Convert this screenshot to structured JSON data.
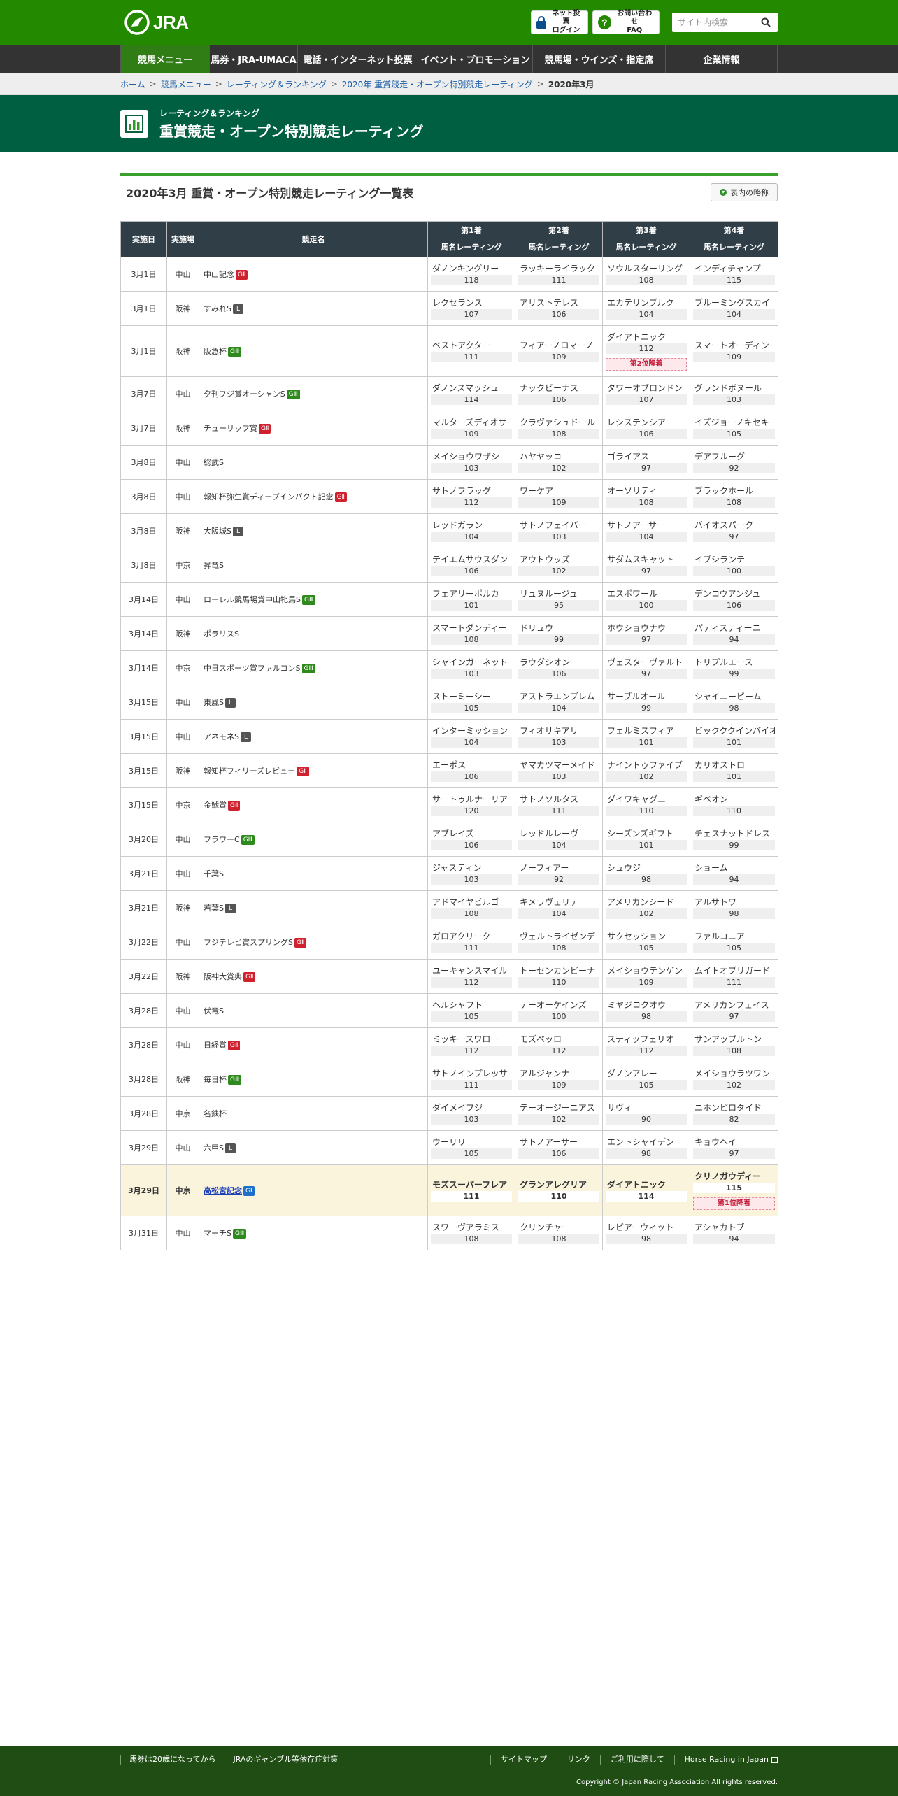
{
  "header": {
    "logo_text": "JRA",
    "login_line1": "ネット投票",
    "login_line2": "ログイン",
    "faq_line1": "お問い合わせ",
    "faq_line2": "FAQ",
    "search_placeholder": "サイト内検索"
  },
  "nav": {
    "items": [
      {
        "label": "競馬メニュー",
        "active": true
      },
      {
        "label": "馬券・JRA-UMACA"
      },
      {
        "label": "電話・インターネット投票"
      },
      {
        "label": "イベント・プロモーション"
      },
      {
        "label": "競馬場・ウインズ・指定席"
      },
      {
        "label": "企業情報"
      }
    ]
  },
  "breadcrumb": {
    "items": [
      "ホーム",
      "競馬メニュー",
      "レーティング＆ランキング",
      "2020年 重賞競走・オープン特別競走レーティング"
    ],
    "current": "2020年3月"
  },
  "title": {
    "sub": "レーティング＆ランキング",
    "main": "重賞競走・オープン特別競走レーティング"
  },
  "section": {
    "title": "2020年3月 重賞・オープン特別競走レーティング一覧表",
    "legend_button": "表内の略称"
  },
  "table": {
    "headers": {
      "date": "実施日",
      "venue": "実施場",
      "race": "競走名",
      "p1": "第1着",
      "p2": "第2着",
      "p3": "第3着",
      "p4": "第4着",
      "sub": "馬名レーティング"
    },
    "rows": [
      {
        "date": "3月1日",
        "venue": "中山",
        "race": "中山記念",
        "grade": "GⅡ",
        "g": "g2",
        "h": [
          [
            "ダノンキングリー",
            "118"
          ],
          [
            "ラッキーライラック",
            "111"
          ],
          [
            "ソウルスターリング",
            "108"
          ],
          [
            "インディチャンプ",
            "115"
          ]
        ]
      },
      {
        "date": "3月1日",
        "venue": "阪神",
        "race": "すみれS",
        "grade": "L",
        "g": "gl",
        "h": [
          [
            "レクセランス",
            "107"
          ],
          [
            "アリストテレス",
            "106"
          ],
          [
            "エカテリンブルク",
            "104"
          ],
          [
            "ブルーミングスカイ",
            "104"
          ]
        ]
      },
      {
        "date": "3月1日",
        "venue": "阪神",
        "race": "阪急杯",
        "grade": "GⅢ",
        "g": "g3",
        "h": [
          [
            "ベストアクター",
            "111"
          ],
          [
            "フィアーノロマーノ",
            "109"
          ],
          [
            "ダイアトニック",
            "112",
            "第2位降着"
          ],
          [
            "スマートオーディン",
            "109"
          ]
        ]
      },
      {
        "date": "3月7日",
        "venue": "中山",
        "race": "夕刊フジ賞オーシャンS",
        "grade": "GⅢ",
        "g": "g3",
        "h": [
          [
            "ダノンスマッシュ",
            "114"
          ],
          [
            "ナックビーナス",
            "106"
          ],
          [
            "タワーオブロンドン",
            "107"
          ],
          [
            "グランドボヌール",
            "103"
          ]
        ]
      },
      {
        "date": "3月7日",
        "venue": "阪神",
        "race": "チューリップ賞",
        "grade": "GⅡ",
        "g": "g2",
        "h": [
          [
            "マルターズディオサ",
            "109"
          ],
          [
            "クラヴァシュドール",
            "108"
          ],
          [
            "レシステンシア",
            "106"
          ],
          [
            "イズジョーノキセキ",
            "105"
          ]
        ]
      },
      {
        "date": "3月8日",
        "venue": "中山",
        "race": "総武S",
        "grade": "",
        "g": "",
        "h": [
          [
            "メイショウワザシ",
            "103"
          ],
          [
            "ハヤヤッコ",
            "102"
          ],
          [
            "ゴライアス",
            "97"
          ],
          [
            "デアフルーグ",
            "92"
          ]
        ]
      },
      {
        "date": "3月8日",
        "venue": "中山",
        "race": "報知杯弥生賞ディープインパクト記念",
        "grade": "GⅡ",
        "g": "g2",
        "h": [
          [
            "サトノフラッグ",
            "112"
          ],
          [
            "ワーケア",
            "109"
          ],
          [
            "オーソリティ",
            "108"
          ],
          [
            "ブラックホール",
            "108"
          ]
        ]
      },
      {
        "date": "3月8日",
        "venue": "阪神",
        "race": "大阪城S",
        "grade": "L",
        "g": "gl",
        "h": [
          [
            "レッドガラン",
            "104"
          ],
          [
            "サトノフェイバー",
            "103"
          ],
          [
            "サトノアーサー",
            "104"
          ],
          [
            "バイオスパーク",
            "97"
          ]
        ]
      },
      {
        "date": "3月8日",
        "venue": "中京",
        "race": "昇竜S",
        "grade": "",
        "g": "",
        "h": [
          [
            "テイエムサウスダン",
            "106"
          ],
          [
            "アウトウッズ",
            "102"
          ],
          [
            "サダムスキャット",
            "97"
          ],
          [
            "イプシランテ",
            "100"
          ]
        ]
      },
      {
        "date": "3月14日",
        "venue": "中山",
        "race": "ローレル競馬場賞中山牝馬S",
        "grade": "GⅢ",
        "g": "g3",
        "h": [
          [
            "フェアリーポルカ",
            "101"
          ],
          [
            "リュヌルージュ",
            "95"
          ],
          [
            "エスポワール",
            "100"
          ],
          [
            "デンコウアンジュ",
            "106"
          ]
        ]
      },
      {
        "date": "3月14日",
        "venue": "阪神",
        "race": "ポラリスS",
        "grade": "",
        "g": "",
        "h": [
          [
            "スマートダンディー",
            "108"
          ],
          [
            "ドリュウ",
            "99"
          ],
          [
            "ホウショウナウ",
            "97"
          ],
          [
            "パティスティーニ",
            "94"
          ]
        ]
      },
      {
        "date": "3月14日",
        "venue": "中京",
        "race": "中日スポーツ賞ファルコンS",
        "grade": "GⅢ",
        "g": "g3",
        "h": [
          [
            "シャインガーネット",
            "103"
          ],
          [
            "ラウダシオン",
            "106"
          ],
          [
            "ヴェスターヴァルト",
            "97"
          ],
          [
            "トリプルエース",
            "99"
          ]
        ]
      },
      {
        "date": "3月15日",
        "venue": "中山",
        "race": "東風S",
        "grade": "L",
        "g": "gl",
        "h": [
          [
            "ストーミーシー",
            "105"
          ],
          [
            "アストラエンブレム",
            "104"
          ],
          [
            "サーブルオール",
            "99"
          ],
          [
            "シャイニービーム",
            "98"
          ]
        ]
      },
      {
        "date": "3月15日",
        "venue": "中山",
        "race": "アネモネS",
        "grade": "L",
        "g": "gl",
        "h": [
          [
            "インターミッション",
            "104"
          ],
          [
            "フィオリキアリ",
            "103"
          ],
          [
            "フェルミスフィア",
            "101"
          ],
          [
            "ビックククインバイオ",
            "101"
          ]
        ]
      },
      {
        "date": "3月15日",
        "venue": "阪神",
        "race": "報知杯フィリーズレビュー",
        "grade": "GⅡ",
        "g": "g2",
        "h": [
          [
            "エーポス",
            "106"
          ],
          [
            "ヤマカツマーメイド",
            "103"
          ],
          [
            "ナイントゥファイブ",
            "102"
          ],
          [
            "カリオストロ",
            "101"
          ]
        ]
      },
      {
        "date": "3月15日",
        "venue": "中京",
        "race": "金鯱賞",
        "grade": "GⅡ",
        "g": "g2",
        "h": [
          [
            "サートゥルナーリア",
            "120"
          ],
          [
            "サトノソルタス",
            "111"
          ],
          [
            "ダイワキャグニー",
            "110"
          ],
          [
            "ギベオン",
            "110"
          ]
        ]
      },
      {
        "date": "3月20日",
        "venue": "中山",
        "race": "フラワーC",
        "grade": "GⅢ",
        "g": "g3",
        "h": [
          [
            "アブレイズ",
            "106"
          ],
          [
            "レッドルレーヴ",
            "104"
          ],
          [
            "シーズンズギフト",
            "101"
          ],
          [
            "チェスナットドレス",
            "99"
          ]
        ]
      },
      {
        "date": "3月21日",
        "venue": "中山",
        "race": "千葉S",
        "grade": "",
        "g": "",
        "h": [
          [
            "ジャスティン",
            "103"
          ],
          [
            "ノーフィアー",
            "92"
          ],
          [
            "シュウジ",
            "98"
          ],
          [
            "ショーム",
            "94"
          ]
        ]
      },
      {
        "date": "3月21日",
        "venue": "阪神",
        "race": "若葉S",
        "grade": "L",
        "g": "gl",
        "h": [
          [
            "アドマイヤビルゴ",
            "108"
          ],
          [
            "キメラヴェリテ",
            "104"
          ],
          [
            "アメリカンシード",
            "102"
          ],
          [
            "アルサトワ",
            "98"
          ]
        ]
      },
      {
        "date": "3月22日",
        "venue": "中山",
        "race": "フジテレビ賞スプリングS",
        "grade": "GⅡ",
        "g": "g2",
        "h": [
          [
            "ガロアクリーク",
            "111"
          ],
          [
            "ヴェルトライゼンデ",
            "108"
          ],
          [
            "サクセッション",
            "105"
          ],
          [
            "ファルコニア",
            "105"
          ]
        ]
      },
      {
        "date": "3月22日",
        "venue": "阪神",
        "race": "阪神大賞典",
        "grade": "GⅡ",
        "g": "g2",
        "h": [
          [
            "ユーキャンスマイル",
            "112"
          ],
          [
            "トーセンカンビーナ",
            "110"
          ],
          [
            "メイショウテンゲン",
            "109"
          ],
          [
            "ムイトオブリガード",
            "111"
          ]
        ]
      },
      {
        "date": "3月28日",
        "venue": "中山",
        "race": "伏竜S",
        "grade": "",
        "g": "",
        "h": [
          [
            "ヘルシャフト",
            "105"
          ],
          [
            "テーオーケインズ",
            "100"
          ],
          [
            "ミヤジコクオウ",
            "98"
          ],
          [
            "アメリカンフェイス",
            "97"
          ]
        ]
      },
      {
        "date": "3月28日",
        "venue": "中山",
        "race": "日経賞",
        "grade": "GⅡ",
        "g": "g2",
        "h": [
          [
            "ミッキースワロー",
            "112"
          ],
          [
            "モズベッロ",
            "112"
          ],
          [
            "スティッフェリオ",
            "112"
          ],
          [
            "サンアップルトン",
            "108"
          ]
        ]
      },
      {
        "date": "3月28日",
        "venue": "阪神",
        "race": "毎日杯",
        "grade": "GⅢ",
        "g": "g3",
        "h": [
          [
            "サトノインプレッサ",
            "111"
          ],
          [
            "アルジャンナ",
            "109"
          ],
          [
            "ダノンアレー",
            "105"
          ],
          [
            "メイショウラツワン",
            "102"
          ]
        ]
      },
      {
        "date": "3月28日",
        "venue": "中京",
        "race": "名鉄杯",
        "grade": "",
        "g": "",
        "h": [
          [
            "ダイメイフジ",
            "103"
          ],
          [
            "テーオージーニアス",
            "102"
          ],
          [
            "サヴィ",
            "90"
          ],
          [
            "ニホンピロタイド",
            "82"
          ]
        ]
      },
      {
        "date": "3月29日",
        "venue": "中山",
        "race": "六甲S",
        "grade": "L",
        "g": "gl",
        "h": [
          [
            "ウーリリ",
            "105"
          ],
          [
            "サトノアーサー",
            "106"
          ],
          [
            "エントシャイデン",
            "98"
          ],
          [
            "キョウヘイ",
            "97"
          ]
        ]
      },
      {
        "date": "3月29日",
        "venue": "中京",
        "race": "高松宮記念",
        "grade": "GⅠ",
        "g": "g1",
        "hl": true,
        "h": [
          [
            "モズスーパーフレア",
            "111"
          ],
          [
            "グランアレグリア",
            "110"
          ],
          [
            "ダイアトニック",
            "114"
          ],
          [
            "クリノガウディー",
            "115",
            "第1位降着"
          ]
        ]
      },
      {
        "date": "3月31日",
        "venue": "中山",
        "race": "マーチS",
        "grade": "GⅢ",
        "g": "g3",
        "h": [
          [
            "スワーヴアラミス",
            "108"
          ],
          [
            "クリンチャー",
            "108"
          ],
          [
            "レピアーウィット",
            "98"
          ],
          [
            "アシャカトブ",
            "94"
          ]
        ]
      }
    ]
  },
  "footer": {
    "left": [
      "馬券は20歳になってから",
      "JRAのギャンブル等依存症対策"
    ],
    "right": [
      "サイトマップ",
      "リンク",
      "ご利用に際して",
      "Horse Racing in Japan"
    ],
    "copyright": "Copyright © Japan Racing Association All rights reserved."
  }
}
